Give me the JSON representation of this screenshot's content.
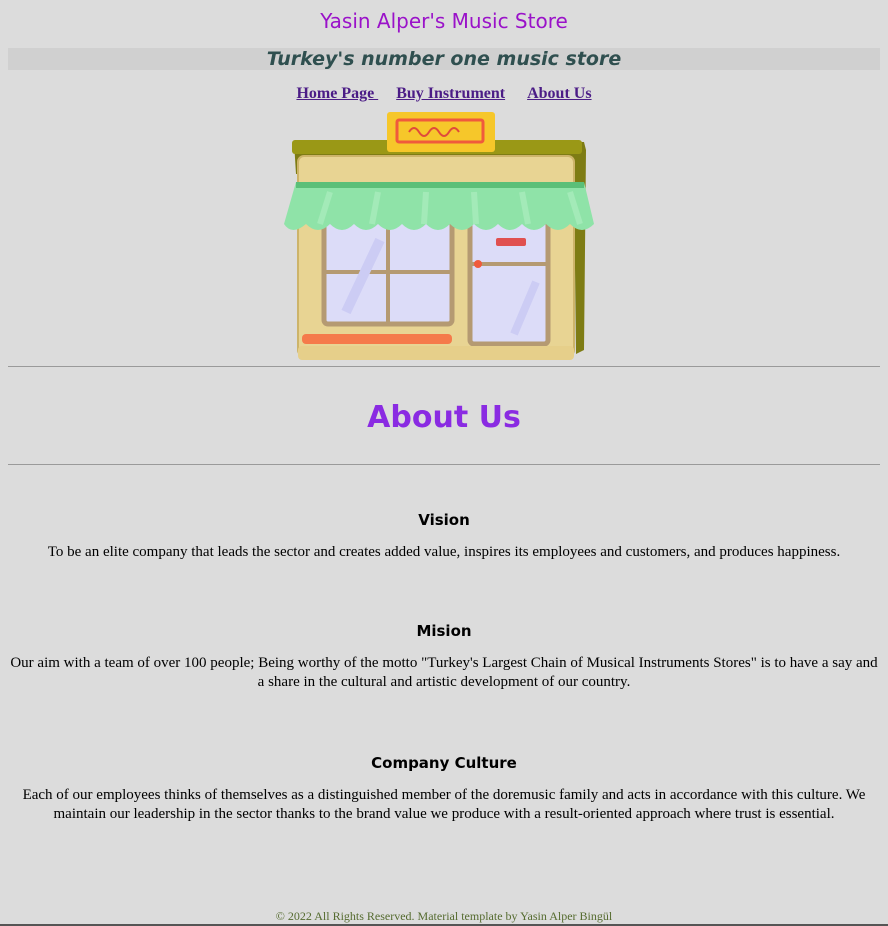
{
  "header": {
    "title": "Yasin Alper's Music Store",
    "slogan": "Turkey's number one music store"
  },
  "nav": {
    "home": "Home Page ",
    "buy": "Buy Instrument",
    "about": " About Us"
  },
  "hero": {
    "image_icon": "storefront-illustration-icon",
    "colors": {
      "awning": "#8fe3a8",
      "sign": "#f6c72a",
      "wall": "#e8d493",
      "roof": "#8a8a1a",
      "window": "#dcdcf8"
    }
  },
  "about": {
    "heading": "About Us"
  },
  "sections": [
    {
      "title": "Vision",
      "text": "To be an elite company that leads the sector and creates added value, inspires its employees and customers, and produces happiness."
    },
    {
      "title": "Mision",
      "text": "Our aim with a team of over 100 people; Being worthy of the motto \"Turkey's Largest Chain of Musical Instruments Stores\" is to have a say and a share in the cultural and artistic development of our country."
    },
    {
      "title": "Company Culture",
      "text": "Each of our employees thinks of themselves as a distinguished member of the doremusic family and acts in accordance with this culture. We maintain our leadership in the sector thanks to the brand value we produce with a result-oriented approach where trust is essential."
    }
  ],
  "footer": {
    "text": "© 2022 All Rights Reserved. Material template by Yasin Alper Bingül"
  }
}
